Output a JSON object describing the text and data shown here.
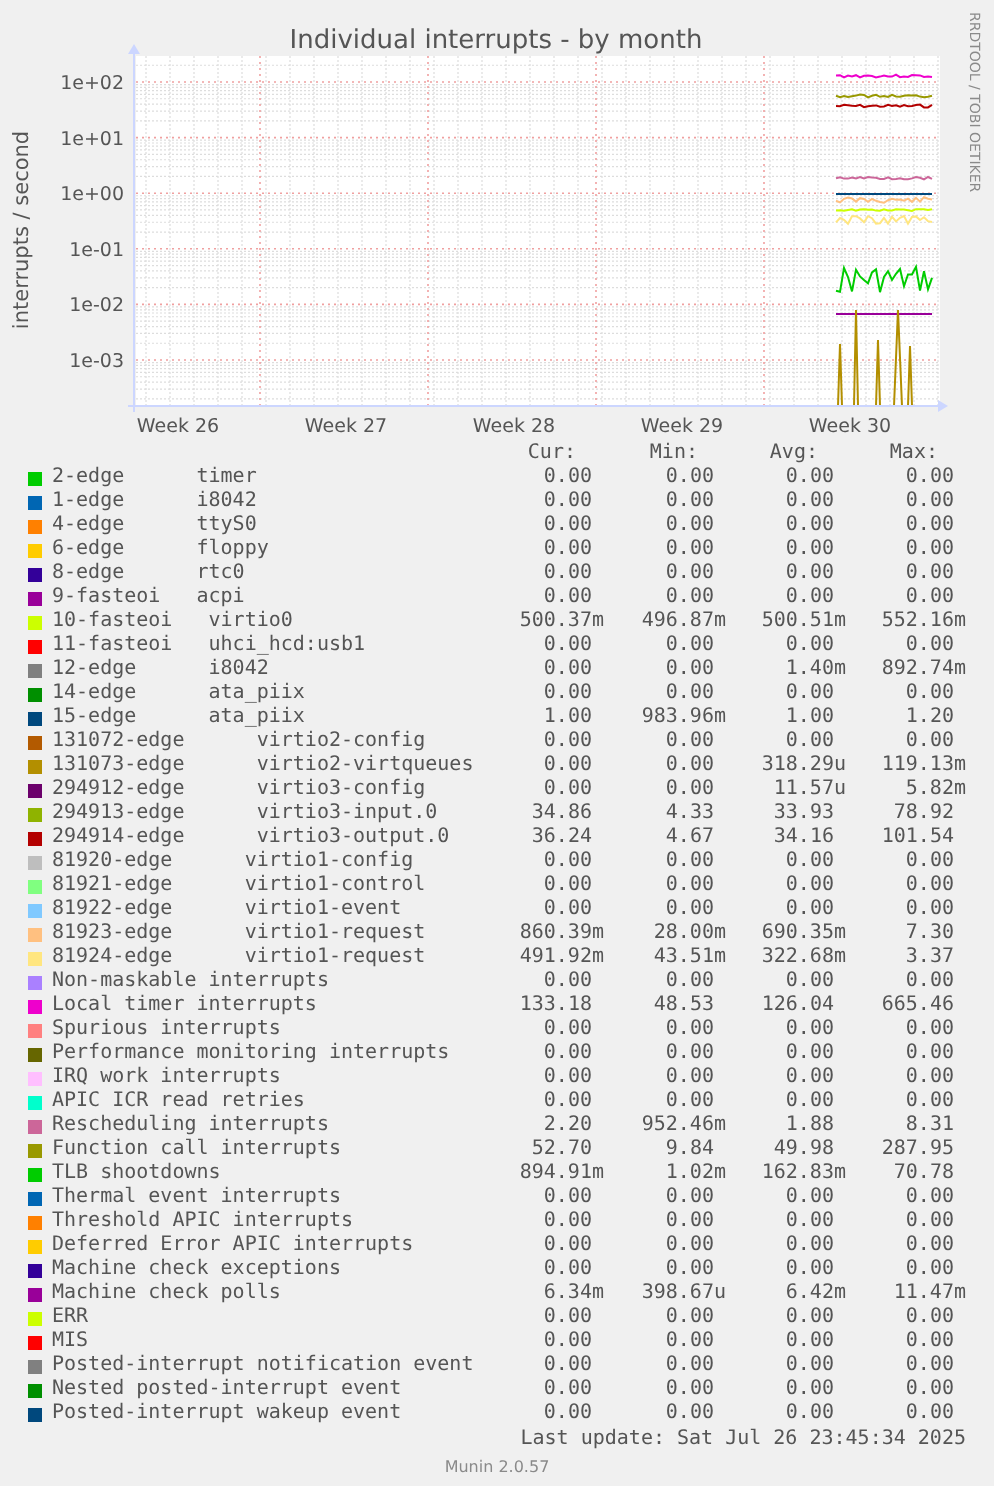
{
  "title": "Individual interrupts - by month",
  "y_axis_label": "interrupts / second",
  "side_text": "RRDTOOL / TOBI OETIKER",
  "y_ticks": [
    "1e+02",
    "1e+01",
    "1e+00",
    "1e-01",
    "1e-02",
    "1e-03"
  ],
  "x_ticks": [
    "Week 26",
    "Week 27",
    "Week 28",
    "Week 29",
    "Week 30"
  ],
  "legend_headers": [
    "Cur:",
    "Min:",
    "Avg:",
    "Max:"
  ],
  "legend": [
    {
      "label": "2-edge      timer",
      "color": "#00cc00",
      "cur": "0.00",
      "min": "0.00",
      "avg": "0.00",
      "max": "0.00"
    },
    {
      "label": "1-edge      i8042",
      "color": "#0066b3",
      "cur": "0.00",
      "min": "0.00",
      "avg": "0.00",
      "max": "0.00"
    },
    {
      "label": "4-edge      ttyS0",
      "color": "#ff8000",
      "cur": "0.00",
      "min": "0.00",
      "avg": "0.00",
      "max": "0.00"
    },
    {
      "label": "6-edge      floppy",
      "color": "#ffcc00",
      "cur": "0.00",
      "min": "0.00",
      "avg": "0.00",
      "max": "0.00"
    },
    {
      "label": "8-edge      rtc0",
      "color": "#330099",
      "cur": "0.00",
      "min": "0.00",
      "avg": "0.00",
      "max": "0.00"
    },
    {
      "label": "9-fasteoi   acpi",
      "color": "#990099",
      "cur": "0.00",
      "min": "0.00",
      "avg": "0.00",
      "max": "0.00"
    },
    {
      "label": "10-fasteoi   virtio0",
      "color": "#ccff00",
      "cur": "500.37m",
      "min": "496.87m",
      "avg": "500.51m",
      "max": "552.16m"
    },
    {
      "label": "11-fasteoi   uhci_hcd:usb1",
      "color": "#ff0000",
      "cur": "0.00",
      "min": "0.00",
      "avg": "0.00",
      "max": "0.00"
    },
    {
      "label": "12-edge      i8042",
      "color": "#808080",
      "cur": "0.00",
      "min": "0.00",
      "avg": "1.40m",
      "max": "892.74m"
    },
    {
      "label": "14-edge      ata_piix",
      "color": "#008f00",
      "cur": "0.00",
      "min": "0.00",
      "avg": "0.00",
      "max": "0.00"
    },
    {
      "label": "15-edge      ata_piix",
      "color": "#00487d",
      "cur": "1.00",
      "min": "983.96m",
      "avg": "1.00",
      "max": "1.20"
    },
    {
      "label": "131072-edge      virtio2-config",
      "color": "#b35a00",
      "cur": "0.00",
      "min": "0.00",
      "avg": "0.00",
      "max": "0.00"
    },
    {
      "label": "131073-edge      virtio2-virtqueues",
      "color": "#b38f00",
      "cur": "0.00",
      "min": "0.00",
      "avg": "318.29u",
      "max": "119.13m"
    },
    {
      "label": "294912-edge      virtio3-config",
      "color": "#6b006b",
      "cur": "0.00",
      "min": "0.00",
      "avg": "11.57u",
      "max": "5.82m"
    },
    {
      "label": "294913-edge      virtio3-input.0",
      "color": "#8fb300",
      "cur": "34.86",
      "min": "4.33",
      "avg": "33.93",
      "max": "78.92"
    },
    {
      "label": "294914-edge      virtio3-output.0",
      "color": "#b30000",
      "cur": "36.24",
      "min": "4.67",
      "avg": "34.16",
      "max": "101.54"
    },
    {
      "label": "81920-edge      virtio1-config",
      "color": "#bebebe",
      "cur": "0.00",
      "min": "0.00",
      "avg": "0.00",
      "max": "0.00"
    },
    {
      "label": "81921-edge      virtio1-control",
      "color": "#80ff80",
      "cur": "0.00",
      "min": "0.00",
      "avg": "0.00",
      "max": "0.00"
    },
    {
      "label": "81922-edge      virtio1-event",
      "color": "#80c9ff",
      "cur": "0.00",
      "min": "0.00",
      "avg": "0.00",
      "max": "0.00"
    },
    {
      "label": "81923-edge      virtio1-request",
      "color": "#ffc080",
      "cur": "860.39m",
      "min": "28.00m",
      "avg": "690.35m",
      "max": "7.30"
    },
    {
      "label": "81924-edge      virtio1-request",
      "color": "#ffe680",
      "cur": "491.92m",
      "min": "43.51m",
      "avg": "322.68m",
      "max": "3.37"
    },
    {
      "label": "Non-maskable interrupts",
      "color": "#aa80ff",
      "cur": "0.00",
      "min": "0.00",
      "avg": "0.00",
      "max": "0.00"
    },
    {
      "label": "Local timer interrupts",
      "color": "#ee00cc",
      "cur": "133.18",
      "min": "48.53",
      "avg": "126.04",
      "max": "665.46"
    },
    {
      "label": "Spurious interrupts",
      "color": "#ff8080",
      "cur": "0.00",
      "min": "0.00",
      "avg": "0.00",
      "max": "0.00"
    },
    {
      "label": "Performance monitoring interrupts",
      "color": "#666600",
      "cur": "0.00",
      "min": "0.00",
      "avg": "0.00",
      "max": "0.00"
    },
    {
      "label": "IRQ work interrupts",
      "color": "#ffbfff",
      "cur": "0.00",
      "min": "0.00",
      "avg": "0.00",
      "max": "0.00"
    },
    {
      "label": "APIC ICR read retries",
      "color": "#00ffcc",
      "cur": "0.00",
      "min": "0.00",
      "avg": "0.00",
      "max": "0.00"
    },
    {
      "label": "Rescheduling interrupts",
      "color": "#cc6699",
      "cur": "2.20",
      "min": "952.46m",
      "avg": "1.88",
      "max": "8.31"
    },
    {
      "label": "Function call interrupts",
      "color": "#999900",
      "cur": "52.70",
      "min": "9.84",
      "avg": "49.98",
      "max": "287.95"
    },
    {
      "label": "TLB shootdowns",
      "color": "#00cc00",
      "cur": "894.91m",
      "min": "1.02m",
      "avg": "162.83m",
      "max": "70.78"
    },
    {
      "label": "Thermal event interrupts",
      "color": "#0066b3",
      "cur": "0.00",
      "min": "0.00",
      "avg": "0.00",
      "max": "0.00"
    },
    {
      "label": "Threshold APIC interrupts",
      "color": "#ff8000",
      "cur": "0.00",
      "min": "0.00",
      "avg": "0.00",
      "max": "0.00"
    },
    {
      "label": "Deferred Error APIC interrupts",
      "color": "#ffcc00",
      "cur": "0.00",
      "min": "0.00",
      "avg": "0.00",
      "max": "0.00"
    },
    {
      "label": "Machine check exceptions",
      "color": "#330099",
      "cur": "0.00",
      "min": "0.00",
      "avg": "0.00",
      "max": "0.00"
    },
    {
      "label": "Machine check polls",
      "color": "#990099",
      "cur": "6.34m",
      "min": "398.67u",
      "avg": "6.42m",
      "max": "11.47m"
    },
    {
      "label": "ERR",
      "color": "#ccff00",
      "cur": "0.00",
      "min": "0.00",
      "avg": "0.00",
      "max": "0.00"
    },
    {
      "label": "MIS",
      "color": "#ff0000",
      "cur": "0.00",
      "min": "0.00",
      "avg": "0.00",
      "max": "0.00"
    },
    {
      "label": "Posted-interrupt notification event",
      "color": "#808080",
      "cur": "0.00",
      "min": "0.00",
      "avg": "0.00",
      "max": "0.00"
    },
    {
      "label": "Nested posted-interrupt event",
      "color": "#008f00",
      "cur": "0.00",
      "min": "0.00",
      "avg": "0.00",
      "max": "0.00"
    },
    {
      "label": "Posted-interrupt wakeup event",
      "color": "#00487d",
      "cur": "0.00",
      "min": "0.00",
      "avg": "0.00",
      "max": "0.00"
    }
  ],
  "last_update": "Last update: Sat Jul 26 23:45:34 2025",
  "footer": "Munin 2.0.57"
}
